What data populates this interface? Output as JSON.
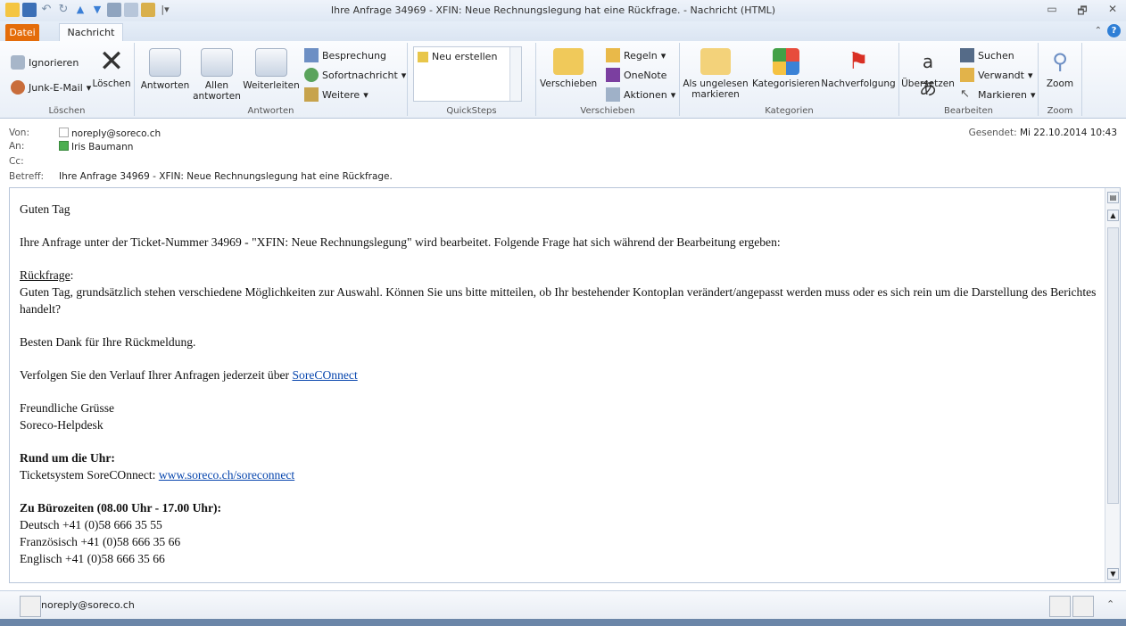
{
  "window": {
    "title": "Ihre Anfrage 34969 - XFIN: Neue Rechnungslegung hat eine Rückfrage. - Nachricht (HTML)",
    "controls": [
      "▭",
      "🗗",
      "✕"
    ]
  },
  "tabs": {
    "file": "Datei",
    "message": "Nachricht"
  },
  "ribbon": {
    "delete_group": {
      "ignore": "Ignorieren",
      "junk": "Junk-E-Mail",
      "delete": "Löschen",
      "label": "Löschen"
    },
    "respond_group": {
      "reply": "Antworten",
      "reply_all_1": "Allen",
      "reply_all_2": "antworten",
      "forward": "Weiterleiten",
      "meeting": "Besprechung",
      "instant": "Sofortnachricht",
      "more": "Weitere",
      "label": "Antworten"
    },
    "quicksteps_group": {
      "new": "Neu erstellen",
      "label": "QuickSteps"
    },
    "move_group": {
      "move": "Verschieben",
      "rules": "Regeln",
      "onenote": "OneNote",
      "actions": "Aktionen",
      "label": "Verschieben"
    },
    "tags_group": {
      "unread_1": "Als ungelesen",
      "unread_2": "markieren",
      "categorize": "Kategorisieren",
      "followup": "Nachverfolgung",
      "label": "Kategorien"
    },
    "edit_group": {
      "translate": "Übersetzen",
      "find": "Suchen",
      "related": "Verwandt",
      "select": "Markieren",
      "label": "Bearbeiten"
    },
    "zoom_group": {
      "zoom": "Zoom",
      "label": "Zoom"
    }
  },
  "header": {
    "from_label": "Von:",
    "from": "noreply@soreco.ch",
    "to_label": "An:",
    "to": "Iris Baumann",
    "cc_label": "Cc:",
    "subject_label": "Betreff:",
    "subject": "Ihre Anfrage 34969 - XFIN: Neue Rechnungslegung hat eine Rückfrage.",
    "sent_label": "Gesendet:",
    "sent": "Mi 22.10.2014 10:43"
  },
  "body": {
    "greeting": "Guten Tag",
    "intro": "Ihre Anfrage unter der Ticket-Nummer 34969  - \"XFIN: Neue Rechnungslegung\" wird bearbeitet. Folgende Frage hat sich während der Bearbeitung ergeben:",
    "question_label": "Rückfrage",
    "question_colon": ":",
    "question": "Guten Tag, grundsätzlich stehen verschiedene Möglichkeiten zur Auswahl. Können Sie uns bitte mitteilen, ob Ihr bestehender Kontoplan verändert/angepasst werden muss oder es sich rein um die Darstellung des Berichtes handelt?",
    "thanks": "Besten Dank für Ihre Rückmeldung.",
    "follow_text": "Verfolgen Sie den Verlauf Ihrer Anfragen jederzeit über ",
    "follow_link": "SoreCOnnect",
    "regards": "Freundliche Grüsse",
    "sender": "Soreco-Helpdesk",
    "clock_heading": "Rund um die Uhr:",
    "ticket_text": "Ticketsystem SoreCOnnect: ",
    "ticket_link": "www.soreco.ch/soreconnect",
    "office_heading": "Zu Bürozeiten (08.00 Uhr - 17.00 Uhr):",
    "phone_de": "Deutsch +41 (0)58 666 35 55",
    "phone_fr": "Französisch +41 (0)58 666 35 66",
    "phone_en": "Englisch +41 (0)58 666 35 66"
  },
  "footer": {
    "sender": "noreply@soreco.ch"
  },
  "colors": {
    "file_tab": "#e46c0a",
    "link": "#0645ad",
    "ribbon_bg": "#e9eff7"
  }
}
